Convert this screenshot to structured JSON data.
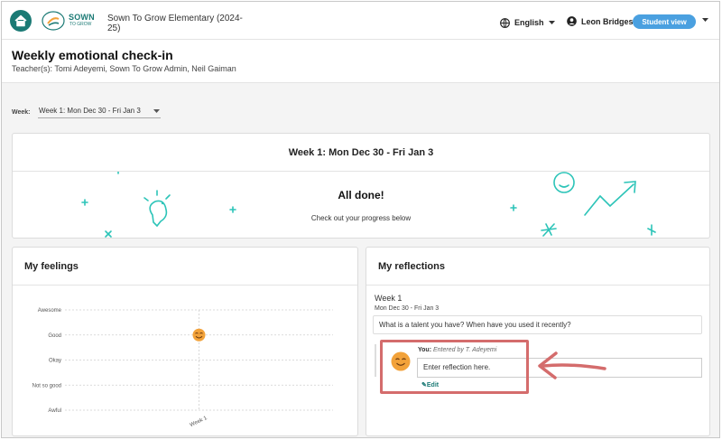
{
  "topbar": {
    "logo_line1": "SOWN",
    "logo_line2": "TO GROW",
    "school": "Sown To Grow Elementary (2024-25)",
    "language": "English",
    "user_name": "Leon Bridges",
    "view_badge": "Student view"
  },
  "header": {
    "title": "Weekly emotional check-in",
    "teachers": "Teacher(s): Tomi Adeyemi, Sown To Grow Admin, Neil Gaiman"
  },
  "week_selector": {
    "label": "Week:",
    "value": "Week 1: Mon Dec 30 - Fri Jan 3"
  },
  "banner": {
    "heading": "Week 1: Mon Dec 30 - Fri Jan 3",
    "done_title": "All done!",
    "done_sub": "Check out your progress below"
  },
  "feelings": {
    "title": "My feelings"
  },
  "chart_data": {
    "type": "scatter",
    "categories": [
      "Week 1"
    ],
    "y_levels": [
      "Awesome",
      "Good",
      "Okay",
      "Not so good",
      "Awful"
    ],
    "points": [
      {
        "x": "Week 1",
        "y": "Good"
      }
    ],
    "grid": true
  },
  "reflections": {
    "title": "My reflections",
    "week": "Week 1",
    "dates": "Mon Dec 30 - Fri Jan 3",
    "question": "What is a talent you have? When have you used it recently?",
    "you_label": "You:",
    "entered_by": "Entered by T. Adeyemi",
    "placeholder": "Enter reflection here.",
    "edit": "Edit"
  },
  "colors": {
    "brand": "#1b7a75",
    "badge": "#4aa0e0",
    "highlight": "#d46c6c",
    "emoji": "#f2a23a"
  }
}
